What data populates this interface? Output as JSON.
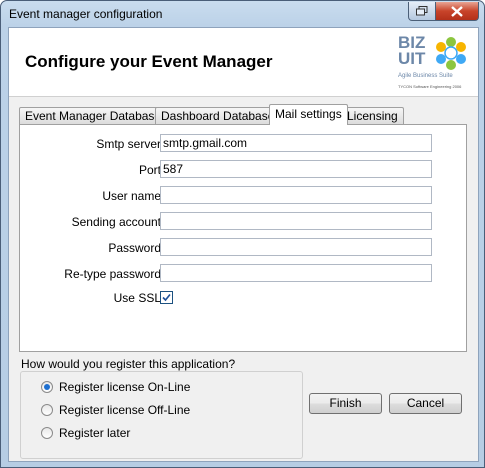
{
  "window": {
    "title": "Event manager configuration"
  },
  "header": {
    "title": "Configure your Event Manager",
    "logo": {
      "brand_line1": "BIZ",
      "brand_line2": "UIT",
      "tagline": "Agile Business Suite",
      "fine_print": "TYCON Software Engineering 2006"
    }
  },
  "tabs": [
    {
      "label": "Event Manager Database",
      "active": false
    },
    {
      "label": "Dashboard Database",
      "active": false
    },
    {
      "label": "Mail settings",
      "active": true
    },
    {
      "label": "Licensing",
      "active": false
    }
  ],
  "mail": {
    "smtp_server": {
      "label": "Smtp server",
      "value": "smtp.gmail.com"
    },
    "port": {
      "label": "Port",
      "value": "587"
    },
    "user_name": {
      "label": "User name",
      "value": ""
    },
    "sending_account": {
      "label": "Sending account",
      "value": ""
    },
    "password": {
      "label": "Password",
      "value": ""
    },
    "retype_password": {
      "label": "Re-type password",
      "value": ""
    },
    "use_ssl": {
      "label": "Use SSL",
      "checked": true
    }
  },
  "register": {
    "question": "How would you register this application?",
    "options": [
      {
        "label": "Register license On-Line",
        "selected": true
      },
      {
        "label": "Register license Off-Line",
        "selected": false
      },
      {
        "label": "Register later",
        "selected": false
      }
    ]
  },
  "buttons": {
    "finish": "Finish",
    "cancel": "Cancel"
  },
  "colors": {
    "accent": "#1d6fd0",
    "titlebar": "#bcd2e8",
    "close": "#c8442a"
  },
  "icons": {
    "restore": "restore-icon",
    "close": "close-icon",
    "check": "checkmark-icon",
    "logo": "bizuit-flower-logo"
  }
}
